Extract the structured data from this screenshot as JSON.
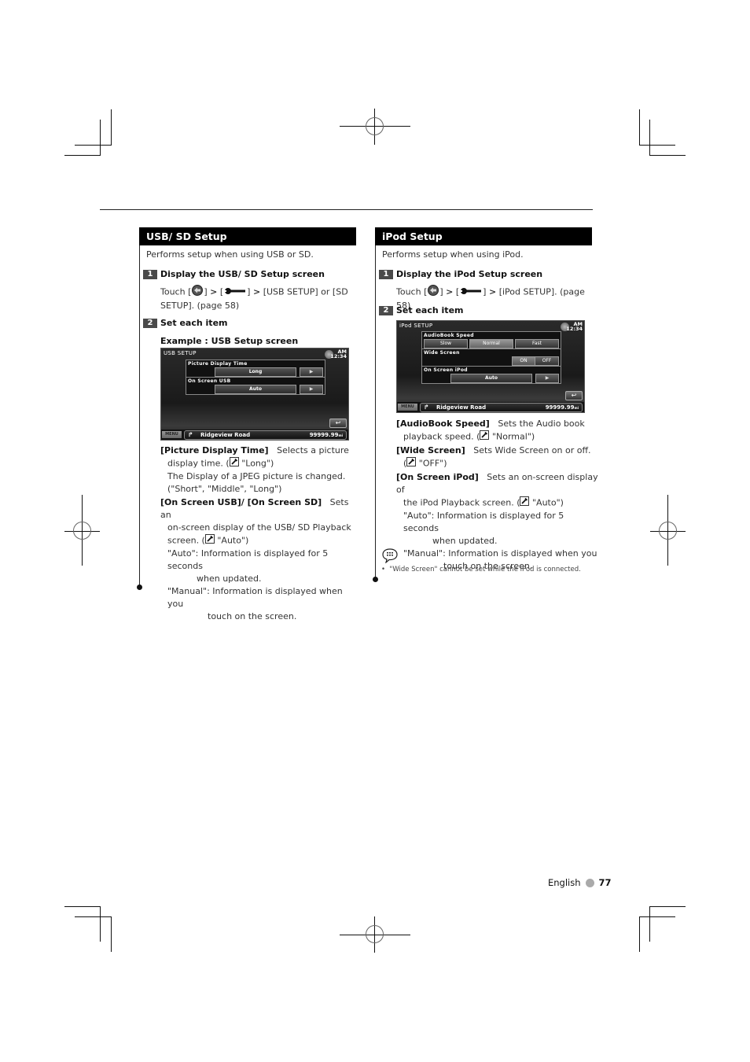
{
  "left_section": {
    "title": "USB/ SD Setup",
    "intro": "Performs setup when using USB or SD.",
    "step1": {
      "number": "1",
      "heading": "Display the USB/ SD Setup screen",
      "touch_label": "Touch [",
      "close_bracket_1": "]",
      "arrow_1": ">",
      "open_bracket_2": "[",
      "close_bracket_2": "]",
      "arrow_2": ">",
      "rest_line1": "[USB SETUP] or [SD",
      "rest_line2": "SETUP]. (page 58)"
    },
    "step2": {
      "number": "2",
      "heading": "Set each item",
      "example_label": "Example : USB Setup screen"
    },
    "screen": {
      "title": "USB SETUP",
      "clock_ampm": "AM",
      "clock_time": "12:34",
      "rows": [
        {
          "label": "Picture Display Time",
          "value": "Long",
          "button": "▶"
        },
        {
          "label": "On Screen USB",
          "value": "Auto",
          "button": "▶"
        }
      ],
      "return_icon": "↩",
      "menu_label": "MENU",
      "nav_arrow": "↱",
      "road": "Ridgeview Road",
      "distance": "99999.99",
      "distance_unit": "mi"
    },
    "items": [
      {
        "name": "[Picture Display Time]",
        "desc_line1": "Selects a picture",
        "desc_line2_pre": "display time. (",
        "default": "\"Long\")",
        "extra_line1": "The Display of a JPEG picture is changed.",
        "extra_line2": "(\"Short\", \"Middle\", \"Long\")"
      },
      {
        "name": "[On Screen USB]/ [On Screen SD]",
        "desc_line1": "Sets an",
        "desc_line2": "on-screen display of the USB/ SD Playback",
        "desc_line3_pre": "screen. (",
        "default": "\"Auto\")",
        "auto_label": "\"Auto\":",
        "auto_text_1": "Information is displayed for 5 seconds",
        "auto_text_2": "when updated.",
        "manual_label": "\"Manual\":",
        "manual_text_1": "Information is displayed when you",
        "manual_text_2": "touch on the screen."
      }
    ]
  },
  "right_section": {
    "title": "iPod Setup",
    "intro": "Performs setup when using iPod.",
    "step1": {
      "number": "1",
      "heading": "Display the iPod Setup screen",
      "touch_label": "Touch [",
      "close_bracket_1": "]",
      "arrow_1": ">",
      "open_bracket_2": "[",
      "close_bracket_2": "]",
      "arrow_2": ">",
      "rest_line1": "[iPod SETUP]. (page 58)"
    },
    "step2": {
      "number": "2",
      "heading": "Set each item"
    },
    "screen": {
      "title": "iPod SETUP",
      "clock_ampm": "AM",
      "clock_time": "12:34",
      "audiobook_label": "AudioBook Speed",
      "audiobook_options": [
        "Slow",
        "Normal",
        "Fast"
      ],
      "widescreen_label": "Wide Screen",
      "widescreen_options": [
        "ON",
        "OFF"
      ],
      "onscreen_label": "On Screen iPod",
      "onscreen_value": "Auto",
      "onscreen_button": "▶",
      "return_icon": "↩",
      "menu_label": "MENU",
      "nav_arrow": "↱",
      "road": "Ridgeview Road",
      "distance": "99999.99",
      "distance_unit": "mi"
    },
    "items": [
      {
        "name": "[AudioBook Speed]",
        "desc_line1": "Sets the Audio book",
        "desc_line2_pre": "playback speed. (",
        "default": "\"Normal\")"
      },
      {
        "name": "[Wide Screen]",
        "desc_line1": "Sets Wide Screen on or off.",
        "desc_line2_pre": "(",
        "default": "\"OFF\")"
      },
      {
        "name": "[On Screen iPod]",
        "desc_line1": "Sets an on-screen display of",
        "desc_line2_pre": "the iPod Playback screen. (",
        "default": "\"Auto\")",
        "auto_label": "\"Auto\":",
        "auto_text_1": "Information is displayed for 5 seconds",
        "auto_text_2": "when updated.",
        "manual_label": "\"Manual\":",
        "manual_text_1": "Information is displayed when you",
        "manual_text_2": "touch on the screen."
      }
    ],
    "note": {
      "bullet": "•",
      "text": "\"Wide Screen\" cannot be set while the iPod is connected."
    }
  },
  "footer": {
    "language": "English",
    "page_number": "77"
  }
}
